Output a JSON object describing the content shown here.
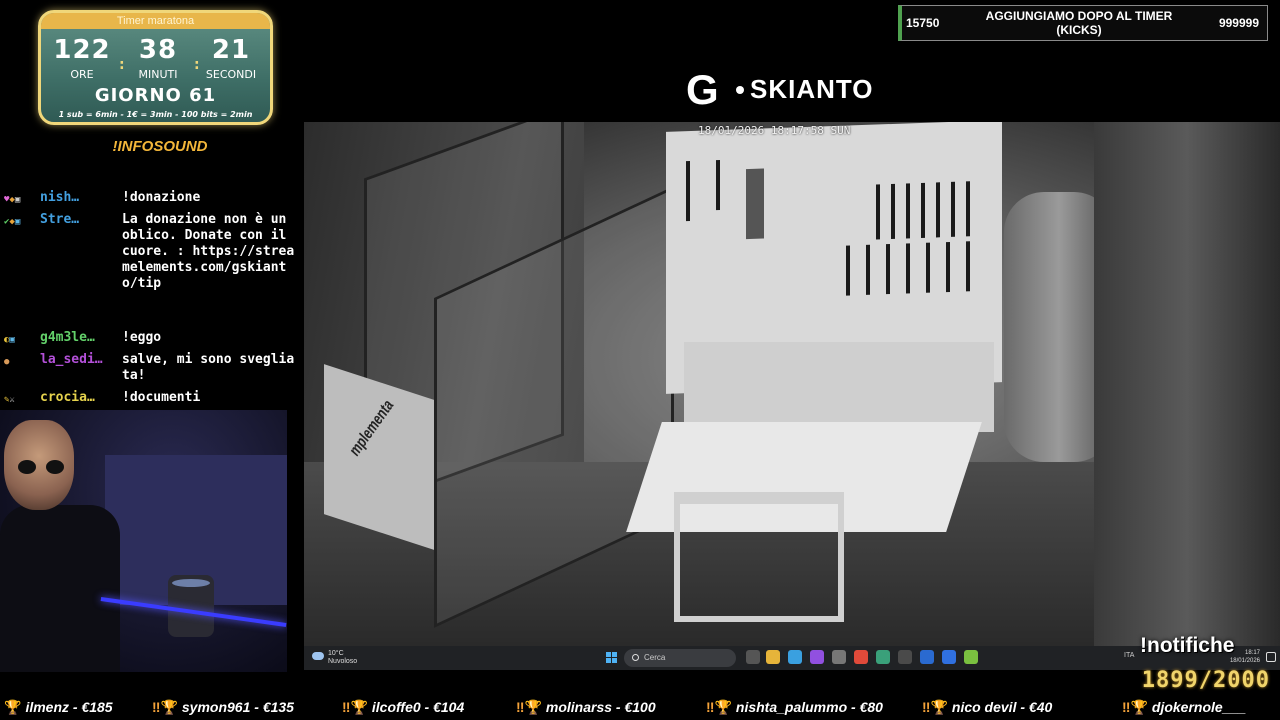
{
  "timer": {
    "title": "Timer maratona",
    "hours": "122",
    "minutes": "38",
    "seconds": "21",
    "hours_label": "ORE",
    "minutes_label": "MINUTI",
    "seconds_label": "SECONDI",
    "day": "GIORNO 61",
    "rates": "1 sub = 6min - 1€ = 3min - 100 bits = 2min"
  },
  "infosound": "!INFOSOUND",
  "chat": [
    {
      "user": "nish…",
      "color": "blue",
      "message": "!donazione"
    },
    {
      "user": "Stre…",
      "color": "blue",
      "message": "La donazione non è un oblico. Donate con il cuore. : https://streamelements.com/gskianto/tip"
    },
    {
      "user": "g4m3le…",
      "color": "green",
      "message": "!eggo"
    },
    {
      "user": "la_sedi…",
      "color": "purple",
      "message": "salve, mi sono svegliata!"
    },
    {
      "user": "crocia…",
      "color": "yellow",
      "message": "!documenti"
    }
  ],
  "counter": {
    "left": "15750",
    "title": "AGGIUNGIAMO DOPO AL TIMER (KICKS)",
    "right": "999999"
  },
  "logo": {
    "letter": "G",
    "name": "SKIANTO"
  },
  "feed": {
    "timestamp": "18/01/2026 18:17:58 SUN",
    "box_label": "mplementa"
  },
  "taskbar": {
    "weather_temp": "10°C",
    "weather_desc": "Nuvoloso",
    "search": "Cerca",
    "lang": "ITA",
    "time": "18:17",
    "date": "18/01/2026"
  },
  "notifiche": "!notifiche",
  "goal": "1899/2000",
  "ticker": [
    "ilmenz - €185",
    "symon961 - €135",
    "ilcoffe0 - €104",
    "molinarss - €100",
    "nishta_palummo - €80",
    "nico devil - €40",
    "djokernole___"
  ],
  "colors": {
    "gold": "#f0d77a",
    "teal": "#4f7f76",
    "accent_orange": "#f3b63a",
    "user_blue": "#43a0e0",
    "user_green": "#63d06a",
    "user_purple": "#b350d8",
    "user_yellow": "#e5d24d"
  }
}
